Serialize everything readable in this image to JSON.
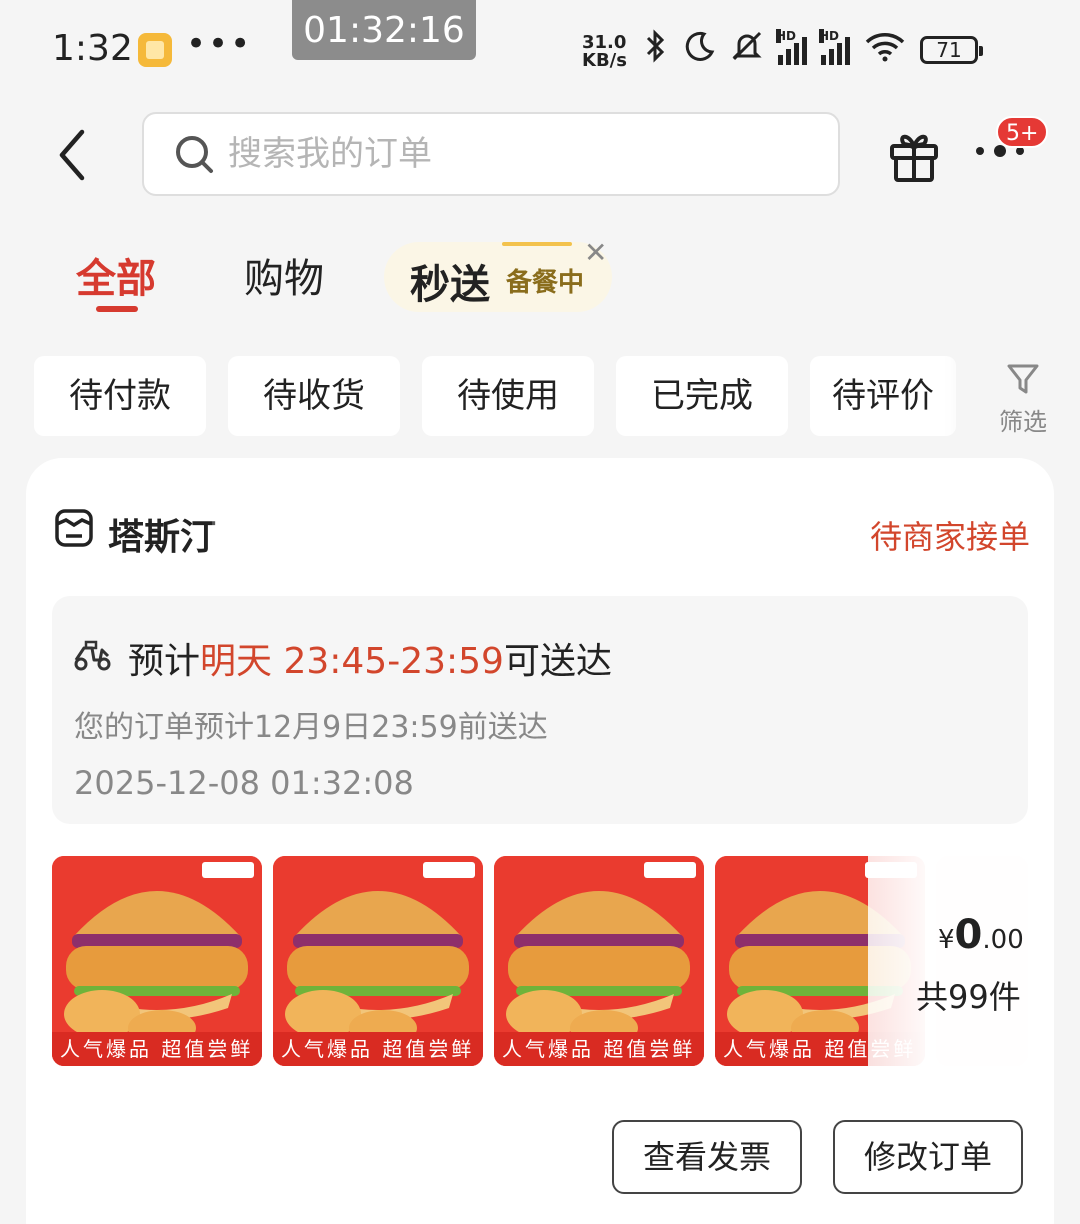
{
  "status_bar": {
    "time": "1:32",
    "more": "•••",
    "network_speed_value": "31.0",
    "network_speed_unit": "KB/s",
    "hd_label": "HD",
    "battery": "71"
  },
  "recording_timer": "01:32:16",
  "search": {
    "placeholder": "搜索我的订单"
  },
  "header": {
    "more_badge": "5+"
  },
  "tabs": {
    "all": "全部",
    "shopping": "购物",
    "flash_delivery": "秒送",
    "flash_status": "备餐中",
    "close": "✕"
  },
  "filters": {
    "items": [
      "待付款",
      "待收货",
      "待使用",
      "已完成",
      "待评价"
    ],
    "filter_label": "筛选"
  },
  "order": {
    "shop_name": "塔斯汀",
    "status": "待商家接单",
    "eta_prefix": "预计",
    "eta_highlight": "明天 23:45-23:59",
    "eta_suffix": "可送达",
    "eta_note": "您的订单预计12月9日23:59前送达",
    "order_time": "2025-12-08 01:32:08",
    "product_caption": "人气爆品  超值尝鲜",
    "price_currency": "¥",
    "price_int": "0",
    "price_dec": ".00",
    "item_count": "共99件"
  },
  "actions": {
    "view_invoice": "查看发票",
    "modify_order": "修改订单"
  },
  "colors": {
    "accent_red": "#d63a2f",
    "status_red": "#d2462c",
    "flash_bg": "#fbf6e6"
  }
}
